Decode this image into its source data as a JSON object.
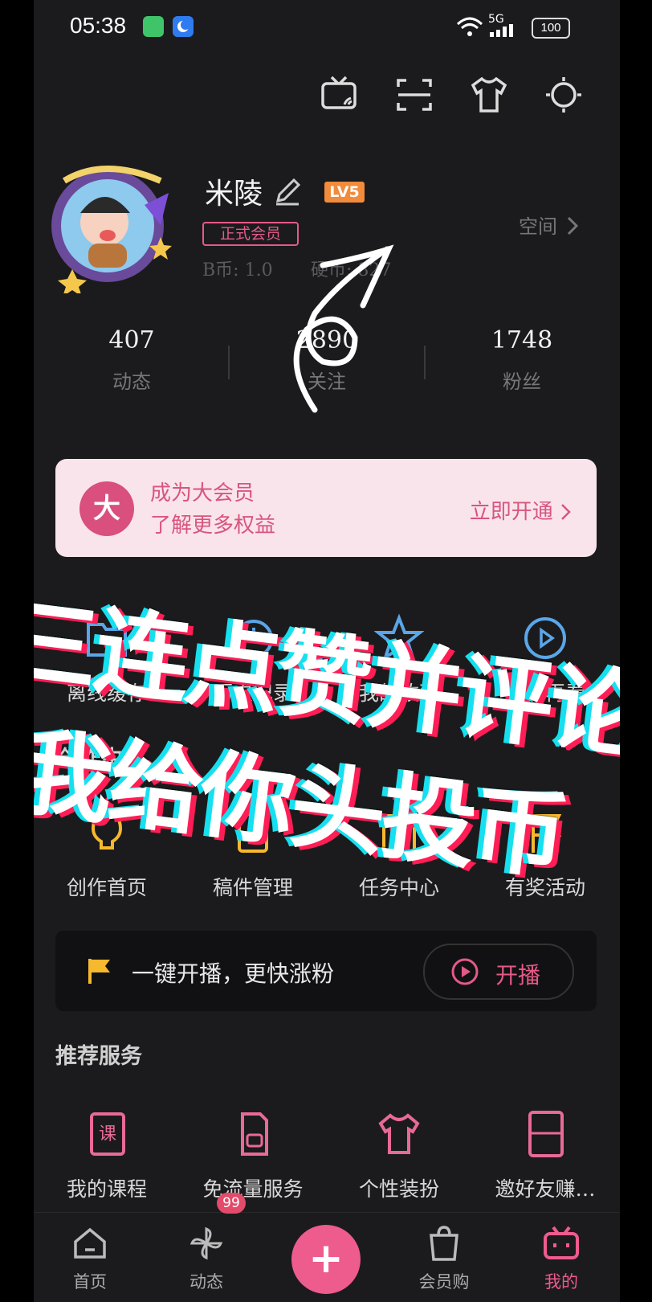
{
  "status": {
    "time": "05:38",
    "network": "5G",
    "battery": "100"
  },
  "profile": {
    "username": "米陵",
    "level": "LV5",
    "vip_tag": "正式会员",
    "bcoin": "B币: 1.0",
    "coin": "硬币: 827",
    "space_link": "空间"
  },
  "stats": [
    {
      "value": "407",
      "label": "动态"
    },
    {
      "value": "2890",
      "label": "关注"
    },
    {
      "value": "1748",
      "label": "粉丝"
    }
  ],
  "vip_banner": {
    "badge": "大",
    "line1": "成为大会员",
    "line2": "了解更多权益",
    "cta": "立即开通"
  },
  "quick_items": [
    {
      "label": "离线缓存"
    },
    {
      "label": "历史记录"
    },
    {
      "label": "我的收藏"
    },
    {
      "label": "稍后再看"
    }
  ],
  "creator": {
    "title": "创作中心",
    "items": [
      {
        "label": "创作首页"
      },
      {
        "label": "稿件管理"
      },
      {
        "label": "任务中心"
      },
      {
        "label": "有奖活动"
      }
    ]
  },
  "live_bar": {
    "text": "一键开播，更快涨粉",
    "button": "开播"
  },
  "services": {
    "title": "推荐服务",
    "items": [
      {
        "label": "我的课程"
      },
      {
        "label": "免流量服务"
      },
      {
        "label": "个性装扮"
      },
      {
        "label": "邀好友赚…"
      }
    ]
  },
  "tabbar": {
    "items": [
      {
        "label": "首页"
      },
      {
        "label": "动态",
        "badge": "99"
      },
      {
        "label": "会员购"
      },
      {
        "label": "我的"
      }
    ]
  },
  "overlay": {
    "line1": "三连点赞并评论",
    "line2": "我给你头投币"
  },
  "colors": {
    "accent": "#e45a86",
    "background": "#1b1b1d",
    "vip_banner": "#f9e4eb",
    "level": "#f28b3b"
  }
}
